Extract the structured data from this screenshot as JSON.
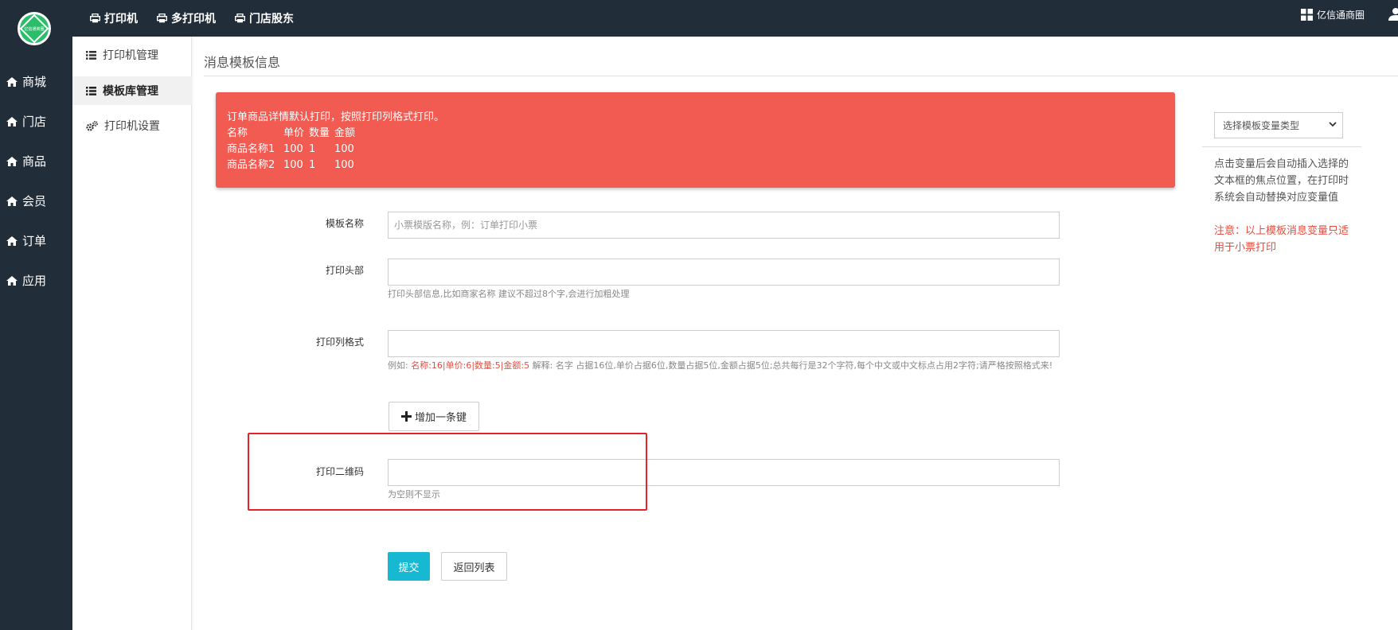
{
  "topbar": {
    "logo_text": "亿信通商圈",
    "nav": [
      {
        "label": "打印机"
      },
      {
        "label": "多打印机"
      },
      {
        "label": "门店股东"
      }
    ],
    "account_name": "亿信通商圈"
  },
  "sidebar": {
    "items": [
      {
        "label": "商城"
      },
      {
        "label": "门店"
      },
      {
        "label": "商品"
      },
      {
        "label": "会员"
      },
      {
        "label": "订单"
      },
      {
        "label": "应用"
      }
    ]
  },
  "subsidebar": {
    "items": [
      {
        "label": "打印机管理",
        "active": false
      },
      {
        "label": "模板库管理",
        "active": true
      },
      {
        "label": "打印机设置",
        "active": false
      }
    ]
  },
  "main": {
    "title": "消息模板信息",
    "alert": {
      "line1": "订单商品详情默认打印，按照打印列格式打印。",
      "header": [
        "名称",
        "单价",
        "数量",
        "金额"
      ],
      "rows": [
        [
          "商品名称1",
          "100",
          "1",
          "100"
        ],
        [
          "商品名称2",
          "100",
          "1",
          "100"
        ]
      ]
    },
    "form": {
      "template_name": {
        "label": "模板名称",
        "value": "",
        "placeholder": "小票模版名称，例：订单打印小票"
      },
      "print_header": {
        "label": "打印头部",
        "value": "",
        "help": "打印头部信息,比如商家名称 建议不超过8个字,会进行加粗处理"
      },
      "print_columns": {
        "label": "打印列格式",
        "value": "",
        "help_prefix": "例如: ",
        "help_example": "名称:16|单价:6|数量:5|金额:5",
        "help_suffix": " 解释: 名字 占据16位,单价占据6位,数量占据5位,金额占据5位;总共每行是32个字符,每个中文或中文标点占用2字符;请严格按照格式来!"
      },
      "add_button": "增加一条键",
      "print_qrcode": {
        "label": "打印二维码",
        "value": "",
        "help": "为空则不显示"
      },
      "submit": "提交",
      "back": "返回列表"
    }
  },
  "right_panel": {
    "select_value": "选择模板变量类型",
    "description": "点击变量后会自动插入选择的文本框的焦点位置，在打印时系统会自动替换对应变量值",
    "note": "注意：以上模板消息变量只适用于小票打印"
  },
  "colors": {
    "topbar": "#222d3a",
    "alert": "#f25b52",
    "submit": "#17b8d1",
    "highlight": "#e8222a",
    "note": "#e74c3c"
  },
  "icons": {
    "topnav": "printer-icon",
    "sidebar": "home-icon",
    "subsidebar_list": "list-icon",
    "subsidebar_settings": "gears-icon",
    "add": "plus-icon",
    "account": "grid-icon",
    "user": "user-icon"
  }
}
